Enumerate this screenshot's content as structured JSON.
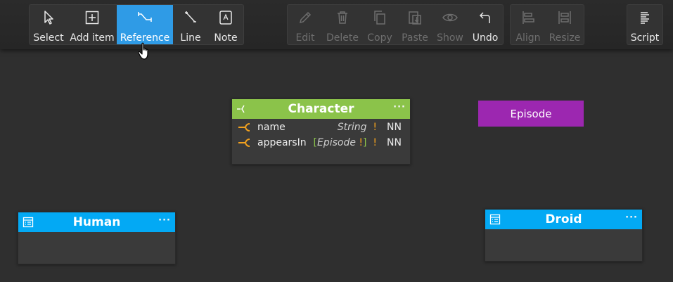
{
  "toolbar": {
    "groups": [
      {
        "items": [
          {
            "label": "Select",
            "icon": "select-icon",
            "state": "normal"
          },
          {
            "label": "Add item",
            "icon": "add-item-icon",
            "state": "normal"
          },
          {
            "label": "Reference",
            "icon": "reference-icon",
            "state": "active"
          },
          {
            "label": "Line",
            "icon": "line-icon",
            "state": "normal"
          },
          {
            "label": "Note",
            "icon": "note-icon",
            "state": "normal"
          }
        ]
      },
      {
        "items": [
          {
            "label": "Edit",
            "icon": "edit-icon",
            "state": "disabled"
          },
          {
            "label": "Delete",
            "icon": "delete-icon",
            "state": "disabled"
          },
          {
            "label": "Copy",
            "icon": "copy-icon",
            "state": "disabled"
          },
          {
            "label": "Paste",
            "icon": "paste-icon",
            "state": "disabled"
          },
          {
            "label": "Show",
            "icon": "show-icon",
            "state": "disabled"
          },
          {
            "label": "Undo",
            "icon": "undo-icon",
            "state": "normal"
          }
        ]
      },
      {
        "items": [
          {
            "label": "Align",
            "icon": "align-icon",
            "state": "disabled"
          },
          {
            "label": "Resize",
            "icon": "resize-icon",
            "state": "disabled"
          }
        ]
      },
      {
        "items": [
          {
            "label": "Script",
            "icon": "script-icon",
            "state": "normal"
          }
        ]
      }
    ]
  },
  "canvas": {
    "character": {
      "title": "Character",
      "header_color": "#8bc34a",
      "kind_icon": "interface-icon",
      "menu": "···",
      "fields": [
        {
          "name": "name",
          "type_open": "",
          "type": "String",
          "type_close": "",
          "required_mark": "!",
          "flag": "NN"
        },
        {
          "name": "appearsIn",
          "type_open": "[",
          "type": "Episode",
          "inner_mark": "!",
          "type_close": "]",
          "required_mark": "!",
          "flag": "NN"
        }
      ]
    },
    "episode": {
      "title": "Episode",
      "color": "#9c27b0"
    },
    "human": {
      "title": "Human",
      "header_color": "#03a9f4",
      "kind_icon": "type-icon",
      "menu": "···"
    },
    "droid": {
      "title": "Droid",
      "header_color": "#03a9f4",
      "kind_icon": "type-icon",
      "menu": "···"
    }
  }
}
